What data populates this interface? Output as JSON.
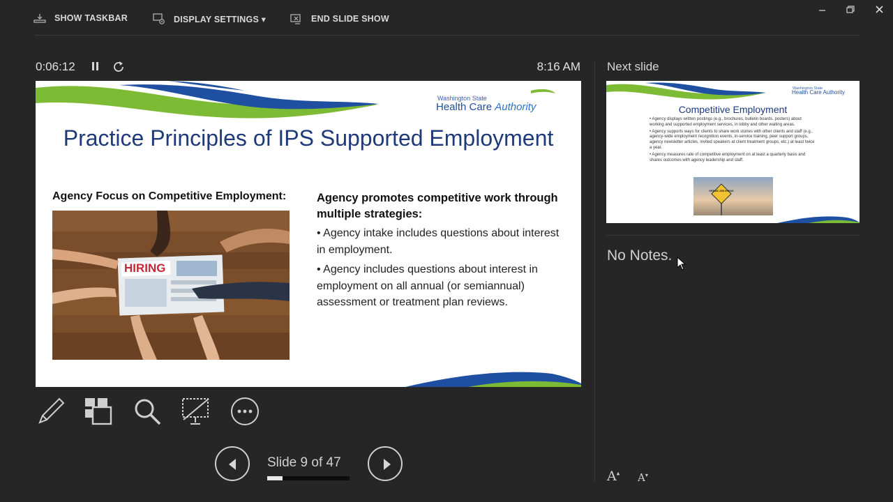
{
  "toolbar": {
    "show_taskbar": "SHOW TASKBAR",
    "display_settings": "DISPLAY SETTINGS ▾",
    "end_slide_show": "END SLIDE SHOW"
  },
  "presenter": {
    "elapsed_time": "0:06:12",
    "clock": "8:16 AM",
    "slide_counter": "Slide 9 of 47",
    "progress_fraction": 0.19
  },
  "current_slide": {
    "logo_small": "Washington State",
    "logo_main_a": "Health Care ",
    "logo_main_b": "Authority",
    "title": "Practice Principles of IPS Supported Employment",
    "left_heading": "Agency Focus on Competitive Employment:",
    "photo_sign": "HIRING",
    "right_heading": "Agency promotes competitive work through multiple strategies:",
    "bullet_1": "• Agency intake includes questions about interest in employment.",
    "bullet_2": "• Agency includes questions about interest in employment on all annual (or semiannual) assessment or treatment plan reviews."
  },
  "next_slide": {
    "label": "Next slide",
    "logo_small": "Washington State",
    "logo_main": "Health Care Authority",
    "title": "Competitive Employment",
    "bullet_1": "• Agency displays written postings (e.g., brochures, bulletin boards, posters) about working and supported employment services, in lobby and other waiting areas.",
    "bullet_2": "• Agency supports ways for clients to share work stories with other clients and staff (e.g., agency-wide employment recognition events, in-service training, peer support groups, agency newsletter articles, invited speakers at client treatment groups, etc.) at least twice a year.",
    "bullet_3": "• Agency measures rate of competitive employment on at least a quarterly basis and shares outcomes with agency leadership and staff.",
    "sign_text": "DREAM JOB AHEAD"
  },
  "notes": {
    "text": "No Notes."
  },
  "font_controls": {
    "increase": "A",
    "decrease": "A"
  },
  "colors": {
    "background": "#262626",
    "slide_title": "#1f3a7a",
    "wave_blue": "#1f4fa0",
    "wave_green": "#7dbb35"
  }
}
